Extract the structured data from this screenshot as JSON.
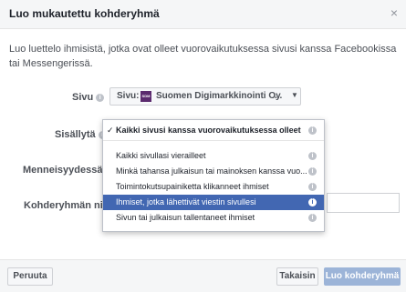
{
  "dialog": {
    "title": "Luo mukautettu kohderyhmä",
    "close_glyph": "×",
    "description": "Luo luettelo ihmisistä, jotka ovat olleet vuorovaikutuksessa sivusi kanssa Facebookissa tai Messengerissä."
  },
  "form": {
    "sivu_label": "Sivu",
    "sisallyta_label": "Sisällytä",
    "menneisyydessa_label": "Menneisyydessä",
    "kohderyhman_nimi_label": "Kohderyhmän nimi",
    "sivu_value_prefix": "Sivu:",
    "sivu_value_name": "Suomen Digimarkkinointi Oy",
    "sivu_value_more": "...",
    "info_glyph": "i",
    "caret_glyph": "▼",
    "check_glyph": "✓"
  },
  "menu": {
    "items": [
      {
        "label": "Kaikki sivusi kanssa vuorovaikutuksessa olleet"
      },
      {
        "label": "Kaikki sivullasi vierailleet"
      },
      {
        "label": "Minkä tahansa julkaisun tai mainoksen kanssa vuo..."
      },
      {
        "label": "Toimintokutsupainiketta klikanneet ihmiset"
      },
      {
        "label": "Ihmiset, jotka lähettivät viestin sivullesi"
      },
      {
        "label": "Sivun tai julkaisun tallentaneet ihmiset"
      }
    ],
    "selected_index": 4
  },
  "footer": {
    "cancel_label": "Peruuta",
    "back_label": "Takaisin",
    "create_label": "Luo kohderyhmä"
  }
}
